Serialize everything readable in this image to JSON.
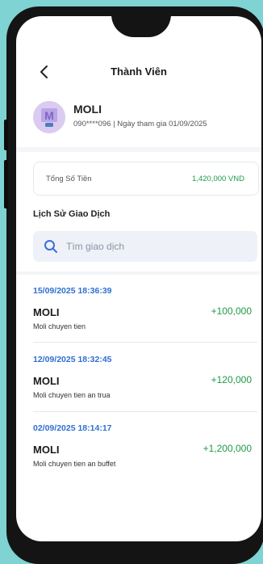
{
  "header": {
    "title": "Thành Viên"
  },
  "user": {
    "name": "MOLI",
    "meta": "090****096 | Ngày tham gia  01/09/2025",
    "avatar_letter": "M"
  },
  "balance": {
    "label": "Tổng Số Tiền",
    "value": "1,420,000 VND"
  },
  "history": {
    "title": "Lịch Sử Giao Dịch",
    "search_placeholder": "Tìm giao dịch",
    "transactions": [
      {
        "date": "15/09/2025 18:36:39",
        "name": "MOLI",
        "amount": "+100,000",
        "note": "Moli chuyen tien"
      },
      {
        "date": "12/09/2025 18:32:45",
        "name": "MOLI",
        "amount": "+120,000",
        "note": "Moli chuyen tien an trua"
      },
      {
        "date": "02/09/2025 18:14:17",
        "name": "MOLI",
        "amount": "+1,200,000",
        "note": "Moli chuyen tien an buffet"
      }
    ]
  },
  "colors": {
    "amount": "#1f9a47",
    "date": "#2f6fd3",
    "background": "#7fd3d3"
  },
  "icons": [
    "back-arrow-icon",
    "search-icon",
    "avatar-icon"
  ]
}
